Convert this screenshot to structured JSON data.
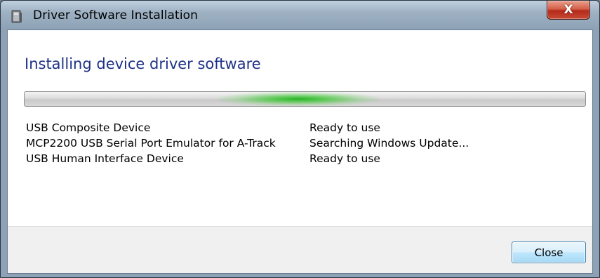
{
  "window": {
    "title": "Driver Software Installation",
    "close_glyph": "X"
  },
  "main": {
    "heading": "Installing device driver software",
    "progress": {
      "state": "indeterminate",
      "accent_color": "#2bb52b"
    },
    "devices": [
      {
        "name": "USB Composite Device",
        "status": "Ready to use"
      },
      {
        "name": "MCP2200 USB Serial Port Emulator for A-Track",
        "status": "Searching Windows Update..."
      },
      {
        "name": "USB Human Interface Device",
        "status": "Ready to use"
      }
    ]
  },
  "footer": {
    "close_label": "Close"
  },
  "icons": {
    "title_icon": "driver-installer-icon",
    "close_icon": "close-icon"
  },
  "colors": {
    "heading": "#1e3287",
    "close_button_red": "#c9402b"
  }
}
